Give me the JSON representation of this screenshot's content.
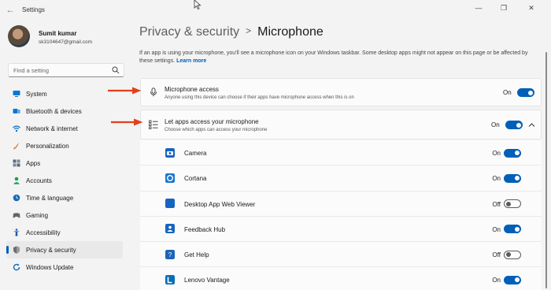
{
  "window": {
    "title": "Settings",
    "back_icon": "back-arrow-icon",
    "controls": [
      "minimize-icon",
      "maximize-icon",
      "close-icon"
    ]
  },
  "profile": {
    "name": "Sumit kumar",
    "email": "sk3104647@gmail.com"
  },
  "search": {
    "placeholder": "Find a setting",
    "icon": "search-icon"
  },
  "nav": {
    "items": [
      {
        "label": "System",
        "icon": "monitor-icon",
        "color": "#0078d4"
      },
      {
        "label": "Bluetooth & devices",
        "icon": "bluetooth-icon",
        "color": "#0078d4"
      },
      {
        "label": "Network & internet",
        "icon": "wifi-icon",
        "color": "#0f6cbd"
      },
      {
        "label": "Personalization",
        "icon": "brush-icon",
        "color": "#c85a12"
      },
      {
        "label": "Apps",
        "icon": "apps-icon",
        "color": "#5b6a7a"
      },
      {
        "label": "Accounts",
        "icon": "person-icon",
        "color": "#1e9e55"
      },
      {
        "label": "Time & language",
        "icon": "globe-clock-icon",
        "color": "#0f6cbd"
      },
      {
        "label": "Gaming",
        "icon": "gamepad-icon",
        "color": "#666666"
      },
      {
        "label": "Accessibility",
        "icon": "accessibility-icon",
        "color": "#1e5aa8"
      },
      {
        "label": "Privacy & security",
        "icon": "shield-icon",
        "color": "#6e6e6e",
        "active": true
      },
      {
        "label": "Windows Update",
        "icon": "update-icon",
        "color": "#0f6cbd"
      }
    ]
  },
  "header": {
    "parent": "Privacy & security",
    "separator": ">",
    "current": "Microphone"
  },
  "description": {
    "text": "If an app is using your microphone, you'll see a microphone icon on your Windows taskbar. Some desktop apps might not appear on this page or be affected by these settings.",
    "link": "Learn more"
  },
  "microphone_access": {
    "title": "Microphone access",
    "subtitle": "Anyone using this device can choose if their apps have microphone access when this is on",
    "state": "On",
    "icon": "microphone-icon"
  },
  "apps_access": {
    "title": "Let apps access your microphone",
    "subtitle": "Choose which apps can access your microphone",
    "state": "On",
    "icon": "list-icon",
    "expand_icon": "chevron-up-icon"
  },
  "apps": [
    {
      "name": "Camera",
      "state": "On",
      "icon": "camera-app-icon",
      "color": "#1565c0"
    },
    {
      "name": "Cortana",
      "state": "On",
      "icon": "cortana-app-icon",
      "color": "#1976d2"
    },
    {
      "name": "Desktop App Web Viewer",
      "state": "Off",
      "icon": "web-viewer-app-icon",
      "color": "#1565c0"
    },
    {
      "name": "Feedback Hub",
      "state": "On",
      "icon": "feedback-hub-app-icon",
      "color": "#1565c0"
    },
    {
      "name": "Get Help",
      "state": "Off",
      "icon": "get-help-app-icon",
      "color": "#1e63b8"
    },
    {
      "name": "Lenovo Vantage",
      "state": "On",
      "icon": "lenovo-vantage-app-icon",
      "color": "#0a6db5"
    }
  ],
  "annotations": {
    "arrow_color": "#e2401c"
  }
}
